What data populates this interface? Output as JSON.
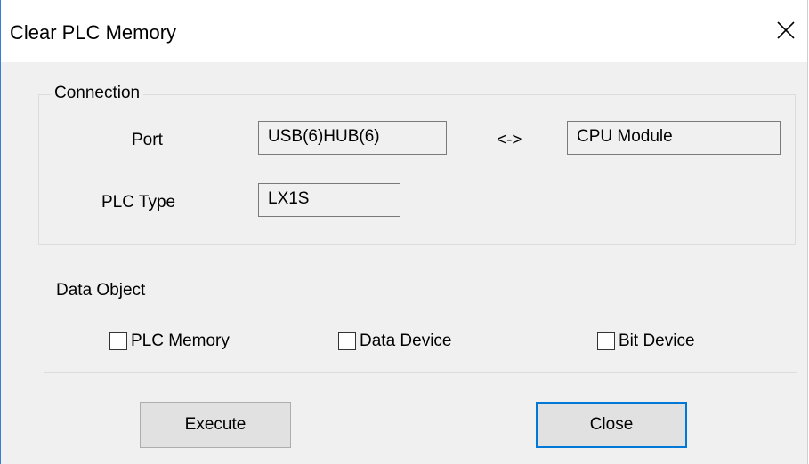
{
  "window": {
    "title": "Clear PLC Memory",
    "close_icon": "close-icon",
    "accent_color": "#0078d7"
  },
  "connection": {
    "legend": "Connection",
    "port_label": "Port",
    "port_value": "USB(6)HUB(6)",
    "arrow": "<->",
    "target_value": "CPU Module",
    "plc_type_label": "PLC Type",
    "plc_type_value": "LX1S"
  },
  "data_object": {
    "legend": "Data Object",
    "options": [
      {
        "label": "PLC Memory",
        "checked": false
      },
      {
        "label": "Data Device",
        "checked": false
      },
      {
        "label": "Bit Device",
        "checked": false
      }
    ]
  },
  "buttons": {
    "execute_label": "Execute",
    "close_label": "Close"
  }
}
